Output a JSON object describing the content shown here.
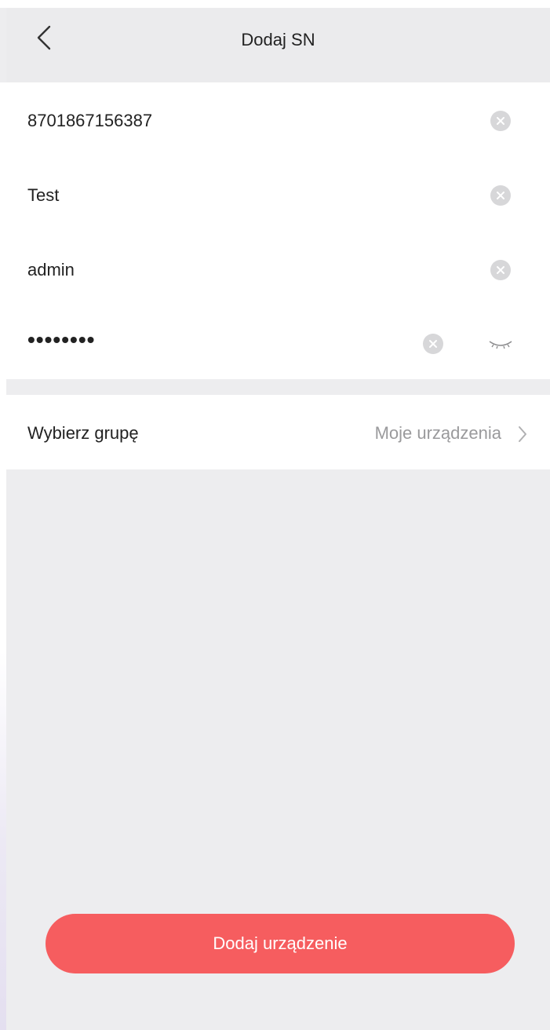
{
  "header": {
    "title": "Dodaj SN",
    "back_icon": "chevron-left-icon"
  },
  "form": {
    "serial_number": "8701867156387",
    "device_name": "Test",
    "username": "admin",
    "password_masked": "••••••••",
    "clear_icon": "clear-circle-icon",
    "eye_icon": "eye-closed-icon"
  },
  "group": {
    "label": "Wybierz grupę",
    "value": "Moje urządzenia",
    "chevron_icon": "chevron-right-icon"
  },
  "actions": {
    "add_device_label": "Dodaj urządzenie"
  },
  "colors": {
    "accent": "#f65d5f",
    "background": "#ededef",
    "header": "#ebebed",
    "text": "#222222",
    "secondary_text": "#9a9a9c"
  }
}
